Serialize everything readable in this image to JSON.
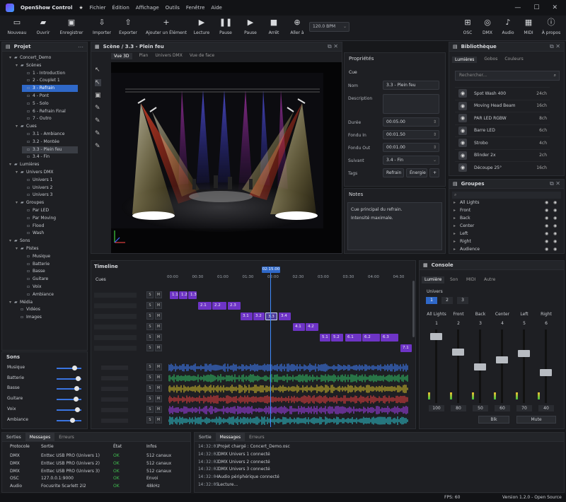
{
  "titlebar": {
    "title": "OpenShow Control",
    "menu": [
      "Fichier",
      "Édition",
      "Affichage",
      "Outils",
      "Fenêtre",
      "Aide"
    ]
  },
  "toolbar": {
    "buttons": [
      "Nouveau",
      "Ouvrir",
      "Enregistrer",
      "Importer",
      "Exporter",
      "Ajouter un Élément",
      "Lecture",
      "Pause",
      "Pause",
      "Arrêt",
      "Aller à"
    ],
    "bpm": "120.0 BPM",
    "right": [
      "OSC",
      "DMX",
      "Audio",
      "MIDI",
      "À propos"
    ]
  },
  "project": {
    "title": "Projet",
    "tree": [
      "Concert_Demo",
      "Scènes",
      "1 - Introduction",
      "2 - Couplet 1",
      "3 - Refrain",
      "4 - Pont",
      "5 - Solo",
      "6 - Refrain Final",
      "7 - Outro",
      "Cues",
      "3.1 - Ambiance",
      "3.2 - Montée",
      "3.3 - Plein feu",
      "3.4 - Fin",
      "Lumières",
      "Univers DMX",
      "Univers 1",
      "Univers 2",
      "Univers 3",
      "Groupes",
      "Par LED",
      "Par Moving",
      "Flood",
      "Wash",
      "Sons",
      "Pistes",
      "Musique",
      "Batterie",
      "Basse",
      "Guitare",
      "Voix",
      "Ambiance",
      "Média",
      "Vidéos",
      "Images"
    ]
  },
  "sons": {
    "title": "Sons",
    "rows": [
      {
        "name": "Musique",
        "v": 0.72
      },
      {
        "name": "Batterie",
        "v": 0.85
      },
      {
        "name": "Basse",
        "v": 0.8
      },
      {
        "name": "Guitare",
        "v": 0.78
      },
      {
        "name": "Voix",
        "v": 0.83
      },
      {
        "name": "Ambiance",
        "v": 0.62
      }
    ]
  },
  "scene": {
    "title": "Scène / 3.3 - Plein feu",
    "tabs": [
      "Vue 3D",
      "Plan",
      "Univers DMX",
      "Vue de face"
    ]
  },
  "props": {
    "title": "Propriétés",
    "section": "Cue",
    "nom_label": "Nom",
    "nom": "3.3 - Plein feu",
    "desc_label": "Description",
    "duree_label": "Durée",
    "duree": "00:05.00",
    "fin_label": "Fondu In",
    "fin": "00:01.50",
    "fout_label": "Fondu Out",
    "fout": "00:01.00",
    "suiv_label": "Suivant",
    "suiv": "3.4 - Fin",
    "tags_label": "Tags",
    "tags": [
      "Refrain",
      "Énergie"
    ]
  },
  "notes": {
    "title": "Notes",
    "l1": "Cue principal du refrain.",
    "l2": "Intensité maximale."
  },
  "library": {
    "title": "Bibliothèque",
    "tabs": [
      "Lumières",
      "Gobos",
      "Couleurs"
    ],
    "search": "Rechercher...",
    "items": [
      {
        "n": "Spot Wash 400",
        "c": "24ch"
      },
      {
        "n": "Moving Head Beam",
        "c": "16ch"
      },
      {
        "n": "PAR LED RGBW",
        "c": "8ch"
      },
      {
        "n": "Barre LED",
        "c": "6ch"
      },
      {
        "n": "Strobo",
        "c": "4ch"
      },
      {
        "n": "Blinder 2x",
        "c": "2ch"
      },
      {
        "n": "Découpe 25°",
        "c": "16ch"
      }
    ]
  },
  "groups": {
    "title": "Groupes",
    "items": [
      "All Lights",
      "Front",
      "Back",
      "Center",
      "Left",
      "Right",
      "Audience"
    ]
  },
  "timeline": {
    "title": "Timeline",
    "cues_label": "Cues",
    "playhead": "02:15.00",
    "ticks": [
      "00:00",
      "00:30",
      "01:00",
      "01:30",
      "02:00",
      "02:30",
      "03:00",
      "03:30",
      "04:00",
      "04:30"
    ],
    "cues": [
      [
        "1.1",
        "1.2",
        "1.3"
      ],
      [
        "2.1",
        "2.2",
        "2.3"
      ],
      [
        "3.1",
        "3.2",
        "3.3",
        "3.4"
      ],
      [
        "4.1",
        "4.2"
      ],
      [
        "5.1",
        "5.2",
        "6.1",
        "6.2",
        "6.3"
      ],
      [
        "7.1"
      ]
    ],
    "sm": [
      "S",
      "M"
    ]
  },
  "console": {
    "title": "Console",
    "tabs": [
      "Lumière",
      "Son",
      "MIDI",
      "Autre"
    ],
    "univers": "Univers",
    "u": [
      "1",
      "2",
      "3"
    ],
    "channels": [
      {
        "n": "All Lights",
        "i": "1",
        "v": "100",
        "f": 0.95
      },
      {
        "n": "Front",
        "i": "2",
        "v": "80",
        "f": 0.72
      },
      {
        "n": "Back",
        "i": "3",
        "v": "50",
        "f": 0.5
      },
      {
        "n": "Center",
        "i": "4",
        "v": "60",
        "f": 0.6
      },
      {
        "n": "Left",
        "i": "5",
        "v": "70",
        "f": 0.7
      },
      {
        "n": "Right",
        "i": "6",
        "v": "40",
        "f": 0.42
      }
    ],
    "blk": "Blk",
    "mute": "Mute"
  },
  "outputs": {
    "tabs": [
      "Sorties",
      "Messages",
      "Erreurs"
    ],
    "headers": [
      "Protocole",
      "Sortie",
      "État",
      "Infos"
    ],
    "rows": [
      [
        "DMX",
        "Enttec USB PRO (Univers 1)",
        "OK",
        "512 canaux"
      ],
      [
        "DMX",
        "Enttec USB PRO (Univers 2)",
        "OK",
        "512 canaux"
      ],
      [
        "DMX",
        "Enttec USB PRO (Univers 3)",
        "OK",
        "512 canaux"
      ],
      [
        "OSC",
        "127.0.0.1:9000",
        "OK",
        "Envoi"
      ],
      [
        "Audio",
        "Focusrite Scarlett 2i2",
        "OK",
        "48kHz"
      ]
    ]
  },
  "log": {
    "tabs": [
      "Sortie",
      "Messages",
      "Erreurs"
    ],
    "rows": [
      [
        "14:32:01",
        "Projet chargé : Concert_Demo.osc"
      ],
      [
        "14:32:02",
        "DMX Univers 1 connecté"
      ],
      [
        "14:32:02",
        "DMX Univers 2 connecté"
      ],
      [
        "14:32:02",
        "DMX Univers 3 connecté"
      ],
      [
        "14:32:04",
        "Audio périphérique connecté"
      ],
      [
        "14:32:05",
        "Lecture..."
      ]
    ]
  },
  "status": {
    "fps": "FPS: 60",
    "version": "Version 1.2.0 - Open Source"
  }
}
